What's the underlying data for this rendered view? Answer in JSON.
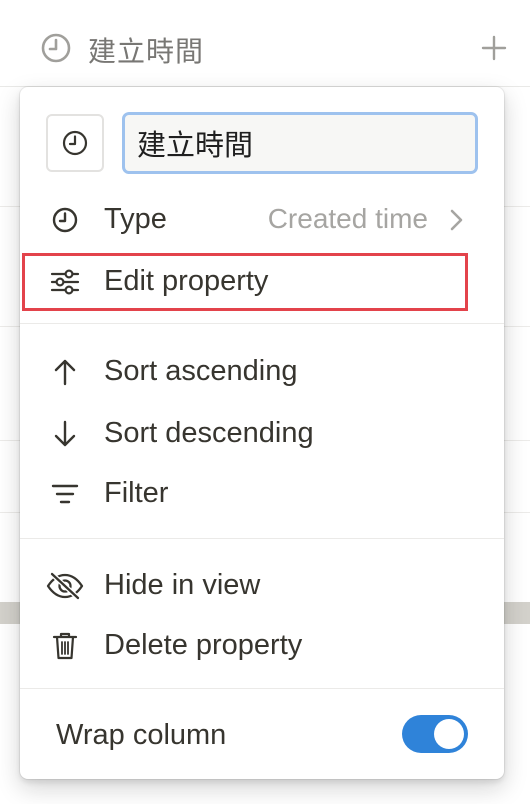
{
  "header": {
    "title": "建立時間",
    "add_icon": "plus-icon",
    "clock_icon": "clock-icon"
  },
  "menu": {
    "property_icon": "clock-icon",
    "name_input": {
      "value": "建立時間"
    },
    "type": {
      "label": "Type",
      "value": "Created time",
      "icon": "clock-icon"
    },
    "edit_property": {
      "label": "Edit property",
      "icon": "sliders-icon"
    },
    "sort_ascending": {
      "label": "Sort ascending",
      "icon": "arrow-up-icon"
    },
    "sort_descending": {
      "label": "Sort descending",
      "icon": "arrow-down-icon"
    },
    "filter": {
      "label": "Filter",
      "icon": "filter-icon"
    },
    "hide_in_view": {
      "label": "Hide in view",
      "icon": "eye-off-icon"
    },
    "delete_property": {
      "label": "Delete property",
      "icon": "trash-icon"
    },
    "wrap_column": {
      "label": "Wrap column",
      "enabled": true
    }
  },
  "colors": {
    "highlight_border": "#e3434b",
    "toggle_on": "#2f83d9",
    "input_focus": "#9ec2ee"
  }
}
